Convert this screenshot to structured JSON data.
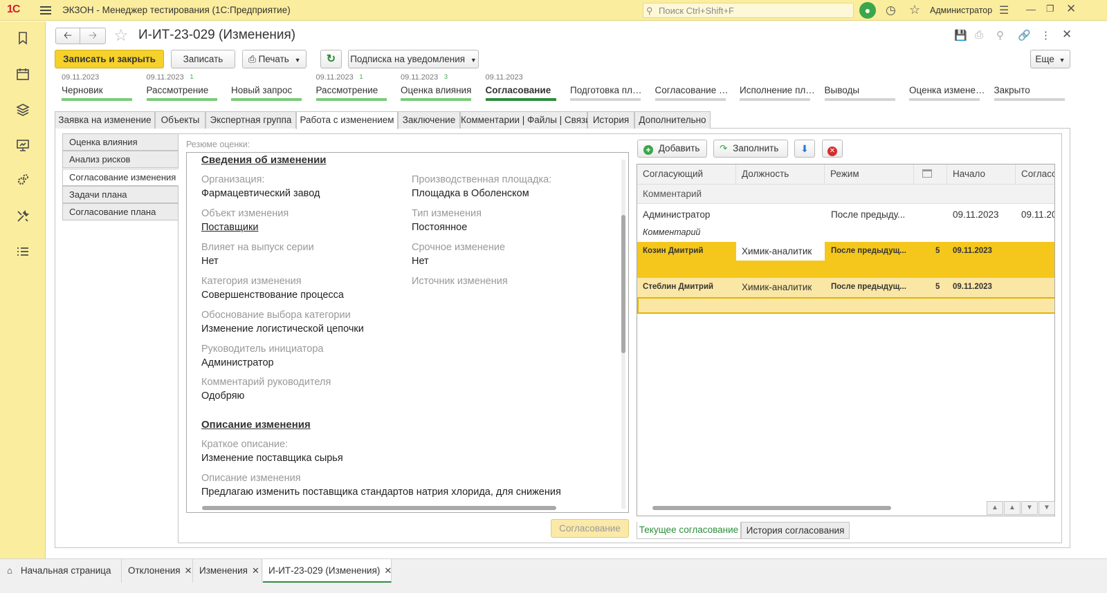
{
  "app": {
    "logo": "1С",
    "title": "ЭКЗОН  - Менеджер тестирования (1С:Предприятие)",
    "search_placeholder": "Поиск Ctrl+Shift+F",
    "user": "Администратор"
  },
  "sidebar": {
    "icons": [
      "bookmark-icon",
      "calendar-icon",
      "layers-icon",
      "presentation-icon",
      "gears-icon",
      "tools-icon",
      "list-icon"
    ]
  },
  "document": {
    "title": "И-ИТ-23-029 (Изменения)"
  },
  "toolbar": {
    "save_close": "Записать и закрыть",
    "save": "Записать",
    "print": "Печать",
    "subscribe": "Подписка на уведомления",
    "more": "Еще"
  },
  "stages": [
    {
      "date": "09.11.2023",
      "count": "",
      "label": "Черновик",
      "state": "done"
    },
    {
      "date": "09.11.2023",
      "count": "1",
      "label": "Рассмотрение",
      "state": "done"
    },
    {
      "date": "",
      "count": "",
      "label": "Новый запрос",
      "state": "done"
    },
    {
      "date": "09.11.2023",
      "count": "1",
      "label": "Рассмотрение",
      "state": "done"
    },
    {
      "date": "09.11.2023",
      "count": "3",
      "label": "Оценка влияния",
      "state": "done"
    },
    {
      "date": "09.11.2023",
      "count": "",
      "label": "Согласование",
      "state": "current"
    },
    {
      "date": "",
      "count": "",
      "label": "Подготовка плана",
      "state": "todo"
    },
    {
      "date": "",
      "count": "",
      "label": "Согласование плана",
      "state": "todo"
    },
    {
      "date": "",
      "count": "",
      "label": "Исполнение плана",
      "state": "todo"
    },
    {
      "date": "",
      "count": "",
      "label": "Выводы",
      "state": "todo"
    },
    {
      "date": "",
      "count": "",
      "label": "Оценка изменения",
      "state": "todo"
    },
    {
      "date": "",
      "count": "",
      "label": "Закрыто",
      "state": "todo"
    }
  ],
  "tabs": [
    "Заявка на изменение",
    "Объекты",
    "Экспертная группа",
    "Работа с изменением",
    "Заключение",
    "Комментарии | Файлы | Связи",
    "История",
    "Дополнительно"
  ],
  "subtabs": [
    "Оценка влияния",
    "Анализ рисков",
    "Согласование изменения",
    "Задачи плана",
    "Согласование плана"
  ],
  "summary": {
    "caption": "Резюме оценки:",
    "section1": "Сведения об изменении",
    "org_label": "Организация:",
    "org_value": "Фармацевтический завод",
    "site_label": "Производственная площадка:",
    "site_value": "Площадка в Оболенском",
    "object_label": "Объект изменения",
    "object_value": "Поставщики",
    "type_label": "Тип изменения",
    "type_value": "Постоянное",
    "batch_label": "Влияет на выпуск серии",
    "batch_value": "Нет",
    "urgent_label": "Срочное изменение",
    "urgent_value": "Нет",
    "category_label": "Категория изменения",
    "category_value": "Совершенствование процесса",
    "source_label": "Источник изменения",
    "reason_label": "Обоснование выбора категории",
    "reason_value": "Изменение логистической цепочки",
    "head_label": "Руководитель инициатора",
    "head_value": "Администратор",
    "comment_label": "Комментарий руководителя",
    "comment_value": "Одобряю",
    "section2": "Описание изменения",
    "short_label": "Краткое описание:",
    "short_value": "Изменение поставщика сырья",
    "desc_label": "Описание изменения",
    "desc_value": "Предлагаю изменить поставщика стандартов натрия хлорида, для снижения"
  },
  "approve_button": "Согласование",
  "approvers": {
    "add": "Добавить",
    "fill": "Заполнить",
    "columns": [
      "Согласующий",
      "Должность",
      "Режим",
      "",
      "Начало",
      "Согласо"
    ],
    "comment_header": "Комментарий",
    "rows": [
      {
        "name": "Администратор",
        "position": "",
        "mode": "После предыду...",
        "num": "",
        "start": "09.11.2023",
        "end": "09.11.20",
        "comment": "Комментарий"
      },
      {
        "name": "Козин Дмитрий",
        "position": "Химик-аналитик",
        "mode": "После предыдущ...",
        "num": "5",
        "start": "09.11.2023",
        "end": "",
        "comment": ""
      },
      {
        "name": "Стеблин Дмитрий",
        "position": "Химик-аналитик",
        "mode": "После предыдущ...",
        "num": "5",
        "start": "09.11.2023",
        "end": "",
        "comment": ""
      }
    ],
    "tab_current": "Текущее согласование",
    "tab_history": "История согласования"
  },
  "taskbar": {
    "home": "Начальная страница",
    "items": [
      "Отклонения",
      "Изменения",
      "И-ИТ-23-029 (Изменения)"
    ]
  }
}
